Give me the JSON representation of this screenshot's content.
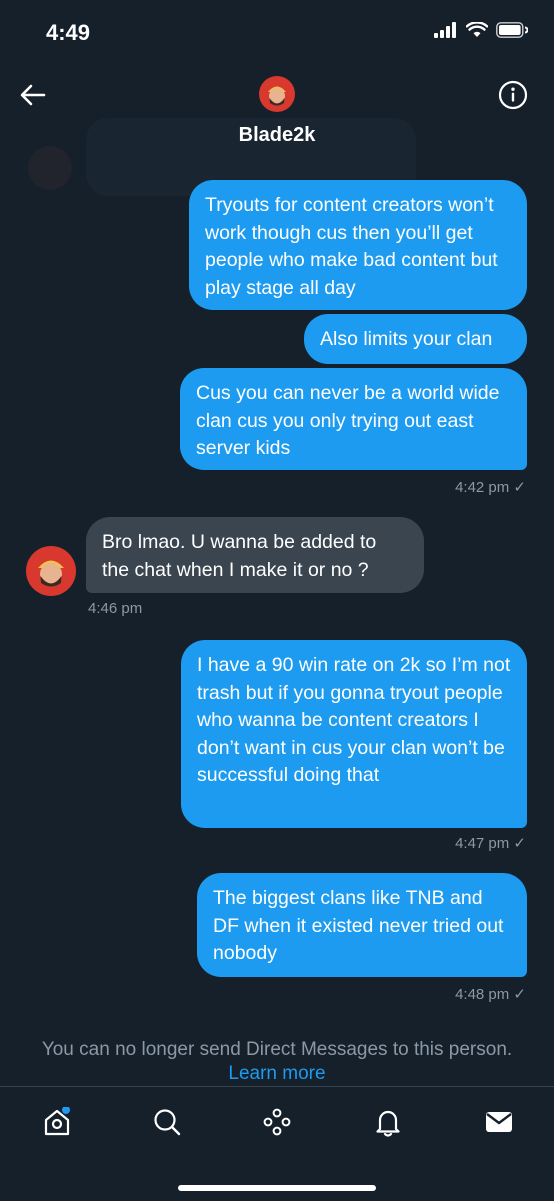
{
  "status": {
    "time": "4:49"
  },
  "header": {
    "name": "Blade2k"
  },
  "messages": [
    {
      "dir": "out",
      "text": "Tryouts for content creators won’t work though cus then you’ll get people who make bad content but play stage all day"
    },
    {
      "dir": "out",
      "text": "Also limits your clan"
    },
    {
      "dir": "out",
      "text": "Cus you can never be a world wide clan cus you only trying out east server kids",
      "time": "4:42 pm ✓"
    },
    {
      "dir": "in",
      "text": "Bro lmao. U wanna be added to the chat when I make it or no ?",
      "time": "4:46 pm"
    },
    {
      "dir": "out",
      "text": "I have a 90 win rate on 2k so I’m not trash but if you gonna tryout people who wanna be content creators I don’t want in cus your clan won’t be successful doing that",
      "time": "4:47 pm ✓"
    },
    {
      "dir": "out",
      "text": "The biggest clans like TNB and DF when it existed never tried out nobody",
      "time": "4:48 pm ✓"
    }
  ],
  "notice": {
    "text": "You can no longer send Direct Messages to this person.",
    "link": "Learn more"
  },
  "tabs": [
    "home-icon",
    "search-icon",
    "spaces-icon",
    "notifications-icon",
    "messages-icon"
  ],
  "colors": {
    "background": "#15202b",
    "outgoing": "#1d9bf0",
    "incoming": "#3a4550",
    "muted": "#8b98a5"
  }
}
